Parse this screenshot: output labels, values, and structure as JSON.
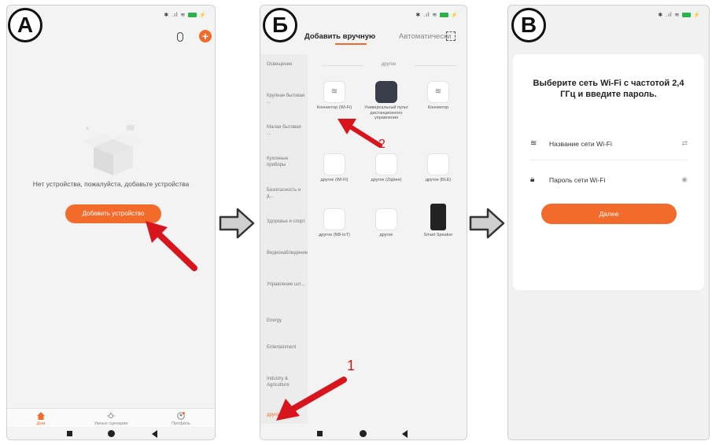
{
  "panels": {
    "a": {
      "badge": "А",
      "empty_message": "Нет устройства, пожалуйста, добавьте устройства",
      "add_device_button": "Добавить устройство",
      "tabs": [
        "Дом",
        "Умные сценарии",
        "Профиль"
      ]
    },
    "b": {
      "badge": "Б",
      "tab_manual": "Добавить вручную",
      "tab_auto": "Автоматически",
      "categories": [
        "Освещение",
        "Крупная бытовая ...",
        "Малая бытовая ...",
        "Кухонные приборы",
        "Безопасность и д...",
        "Здоровье и спорт",
        "Видеонаблюдение",
        "Управление шл...",
        "Energy",
        "Entertainment",
        "Industry & Agriculture",
        "другое"
      ],
      "group_label": "другое",
      "devices": [
        "Коннектор (Wi-Fi)",
        "Универсальный пульт дистанционного управления",
        "Коннектор",
        "другое (Wi-Fi)",
        "другое (Zigbee)",
        "другое (BLE)",
        "другое (NB-IoT)",
        "другое",
        "Smart Speaker"
      ],
      "callouts": [
        "1",
        "2"
      ]
    },
    "c": {
      "badge": "В",
      "title": "Выберите сеть Wi-Fi с частотой 2,4 ГГц и введите пароль.",
      "wifi_name_label": "Название сети Wi-Fi",
      "wifi_password_label": "Пароль сети Wi-Fi",
      "next_button": "Далее"
    }
  },
  "colors": {
    "accent": "#f26b2b",
    "callout_red": "#d8141c"
  },
  "icons": [
    "microphone-icon",
    "plus-icon",
    "home-icon",
    "sun-icon",
    "profile-icon",
    "scan-icon",
    "wifi-icon",
    "lock-icon",
    "eye-icon",
    "swap-icon"
  ]
}
